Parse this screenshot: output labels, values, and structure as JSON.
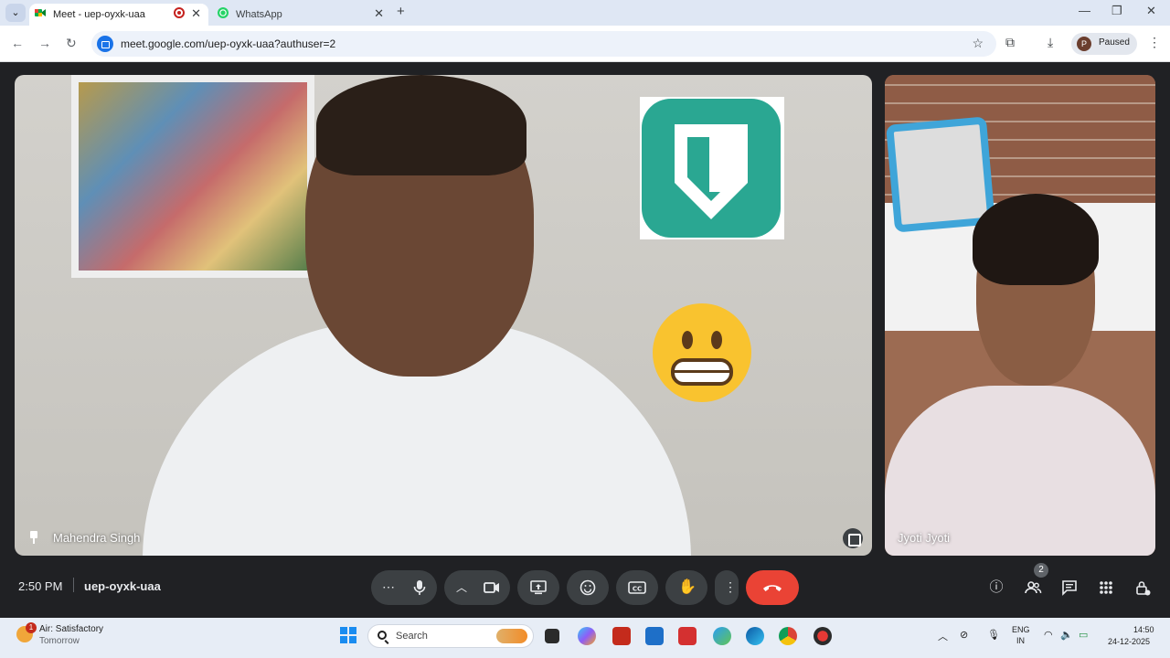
{
  "browser": {
    "tabs": [
      {
        "title": "Meet - uep-oyxk-uaa",
        "active": true,
        "recording": true
      },
      {
        "title": "WhatsApp",
        "active": false
      }
    ],
    "url": "meet.google.com/uep-oyxk-uaa?authuser=2",
    "profile_initial": "P",
    "profile_status": "Paused"
  },
  "meet": {
    "participants": [
      {
        "name": "Mahendra Singh",
        "pinned": true
      },
      {
        "name": "Jyoti Jyoti"
      }
    ],
    "reaction": "grimacing-face",
    "time": "2:50 PM",
    "meeting_code": "uep-oyxk-uaa",
    "people_count": "2",
    "colors": {
      "end_call": "#ea4335",
      "bar_bg": "#202124",
      "control_bg": "#3c4043",
      "app_tile": "#2aa792"
    }
  },
  "taskbar": {
    "weather_title": "Air: Satisfactory",
    "weather_subtitle": "Tomorrow",
    "weather_badge": "1",
    "search_placeholder": "Search",
    "language_line1": "ENG",
    "language_line2": "IN",
    "clock_time": "14:50",
    "clock_date": "24-12-2025"
  }
}
